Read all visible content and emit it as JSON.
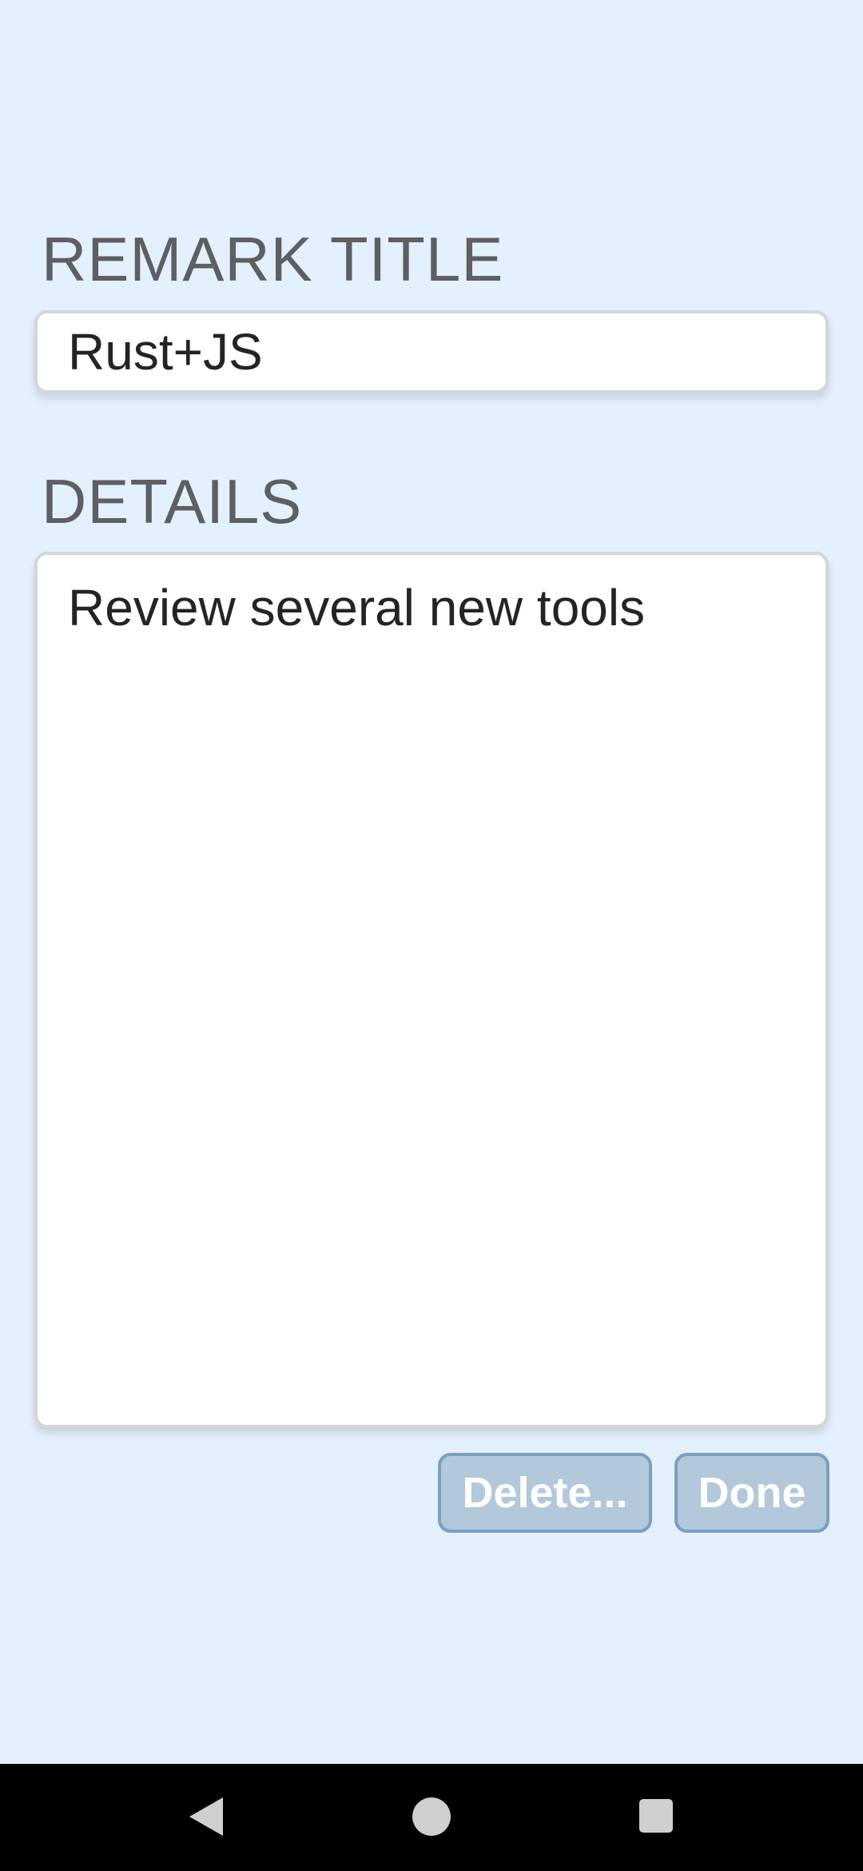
{
  "form": {
    "title_label": "REMARK TITLE",
    "title_value": "Rust+JS",
    "details_label": "DETAILS",
    "details_value": "Review several new tools"
  },
  "actions": {
    "delete_label": "Delete...",
    "done_label": "Done"
  },
  "colors": {
    "background": "#e3f0fd",
    "button_fill": "#b3c8da",
    "button_border": "#7b9fbf"
  },
  "nav_icons": [
    "back-icon",
    "home-icon",
    "recent-apps-icon"
  ]
}
